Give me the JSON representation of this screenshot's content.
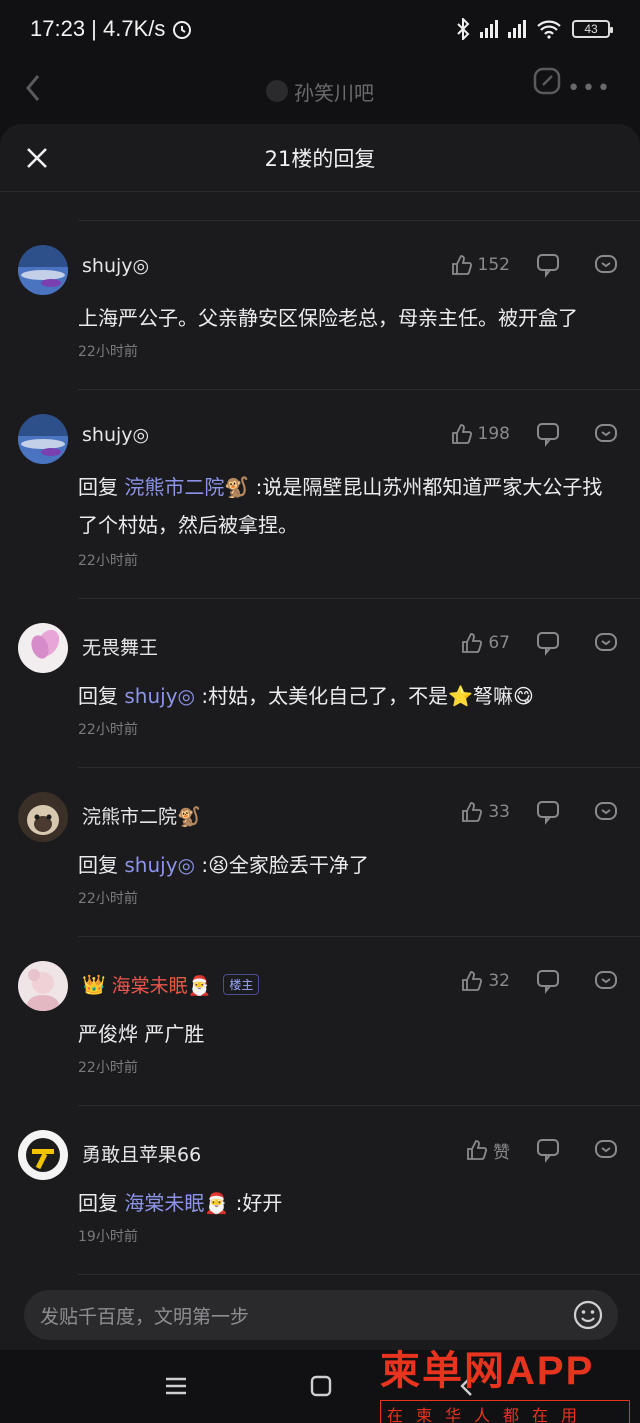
{
  "status_bar": {
    "time": "17:23",
    "speed": "4.7K/s",
    "battery": "43"
  },
  "page": {
    "forum_name": "孙笑川吧"
  },
  "sheet": {
    "title": "21楼的回复",
    "input_placeholder": "发贴千百度，文明第一步"
  },
  "reply_word": "回复",
  "comments": [
    {
      "name": "shujy◎",
      "likes": "152",
      "content": "上海严公子。父亲静安区保险老总，母亲主任。被开盒了",
      "time": "22小时前"
    },
    {
      "name": "shujy◎",
      "likes": "198",
      "mention": "浣熊市二院🐒",
      "content": ":说是隔壁昆山苏州都知道严家大公子找了个村姑，然后被拿捏。",
      "time": "22小时前"
    },
    {
      "name": "无畏舞王",
      "likes": "67",
      "mention": "shujy◎",
      "content": ":村姑，太美化自己了，不是⭐弩嘛😋",
      "time": "22小时前"
    },
    {
      "name": "浣熊市二院🐒",
      "likes": "33",
      "mention": "shujy◎",
      "content": ":😫全家脸丢干净了",
      "time": "22小时前"
    },
    {
      "name": "海棠未眠🎅",
      "crown": "👑",
      "badge": "楼主",
      "likes": "32",
      "content": "严俊烨 严广胜",
      "time": "22小时前"
    },
    {
      "name": "勇敢且苹果66",
      "likes": "赞",
      "mention": "海棠未眠🎅",
      "content": ":好开",
      "time": "19小时前"
    }
  ],
  "watermark": {
    "brand": "柬单网APP",
    "slogan": "在柬华人都在用"
  },
  "colors": {
    "background": "#111113",
    "sheet": "#1b1b1d",
    "mention": "#8c93e8",
    "host_name": "#e8554a",
    "watermark": "#e8341f"
  }
}
